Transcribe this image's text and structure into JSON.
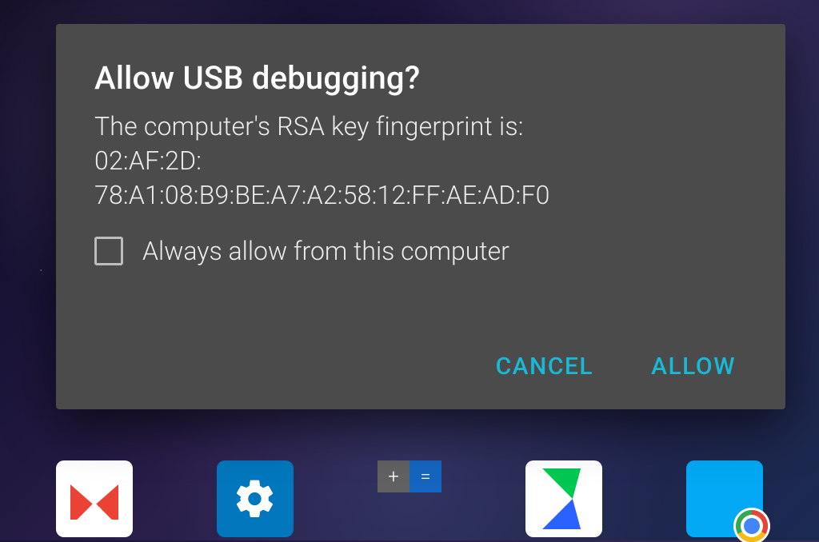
{
  "dialog": {
    "title": "Allow USB debugging?",
    "body_intro": "The computer's RSA key fingerprint is:",
    "fingerprint_line1": "02:AF:2D:",
    "fingerprint_line2": "78:A1:08:B9:BE:A7:A2:58:12:FF:AE:AD:F0",
    "always_allow_label": "Always allow from this computer",
    "always_allow_checked": false,
    "cancel_label": "CANCEL",
    "allow_label": "ALLOW"
  },
  "dock": {
    "icons": [
      "gmail",
      "settings",
      "calculator",
      "play-store",
      "app-with-chrome-badge"
    ]
  },
  "colors": {
    "dialog_bg": "#4b4b4b",
    "accent": "#18b9d4"
  }
}
